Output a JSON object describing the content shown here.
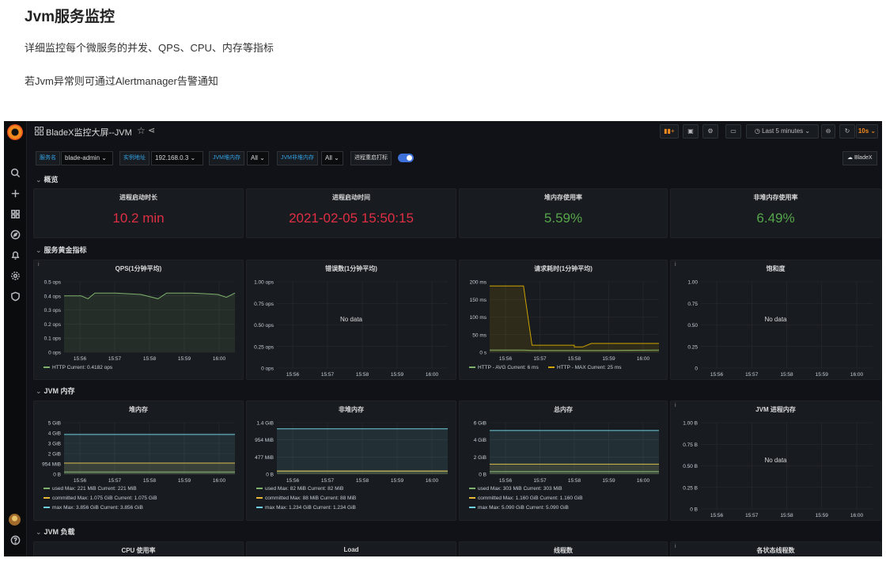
{
  "article": {
    "title": "Jvm服务监控",
    "desc1": "详细监控每个微服务的并发、QPS、CPU、内存等指标",
    "desc2": "若Jvm异常则可通过Alertmanager告警通知"
  },
  "dashboard": {
    "title": "BladeX监控大屏--JVM",
    "time_range": "Last 5 minutes",
    "refresh": "10s",
    "link": "BladeX",
    "vars": [
      {
        "label": "服务名",
        "value": "blade-admin"
      },
      {
        "label": "实例地址",
        "value": "192.168.0.3"
      },
      {
        "label": "JVM堆内存",
        "value": "All"
      },
      {
        "label": "JVM非堆内存",
        "value": "All"
      }
    ],
    "toggle_label": "进程重启打标"
  },
  "rows": {
    "overview": "概览",
    "golden": "服务黄金指标",
    "jvm_mem": "JVM 内存",
    "jvm_load": "JVM 负载"
  },
  "stats": [
    {
      "title": "进程启动时长",
      "value": "10.2 min",
      "color": "#e02f44"
    },
    {
      "title": "进程启动时间",
      "value": "2021-02-05 15:50:15",
      "color": "#e02f44"
    },
    {
      "title": "堆内存使用率",
      "value": "5.59%",
      "color": "#56a64b"
    },
    {
      "title": "非堆内存使用率",
      "value": "6.49%",
      "color": "#56a64b"
    }
  ],
  "nodata_text": "No data",
  "chart_data": [
    {
      "type": "line",
      "title": "QPS(1分钟平均)",
      "x": [
        "15:56",
        "15:57",
        "15:58",
        "15:59",
        "16:00"
      ],
      "yticks": [
        "0 ops",
        "0.1 ops",
        "0.2 ops",
        "0.3 ops",
        "0.4 ops",
        "0.5 ops"
      ],
      "ylim": [
        0,
        0.5
      ],
      "series": [
        {
          "name": "HTTP",
          "legend": "HTTP  Current: 0.4182 ops",
          "color": "#7eb26d",
          "points": [
            [
              0,
              0.4
            ],
            [
              0.1,
              0.4
            ],
            [
              0.14,
              0.38
            ],
            [
              0.18,
              0.42
            ],
            [
              0.3,
              0.42
            ],
            [
              0.45,
              0.41
            ],
            [
              0.55,
              0.38
            ],
            [
              0.6,
              0.42
            ],
            [
              0.75,
              0.42
            ],
            [
              0.9,
              0.41
            ],
            [
              0.95,
              0.39
            ],
            [
              1,
              0.42
            ]
          ]
        }
      ]
    },
    {
      "type": "line",
      "title": "错误数(1分钟平均)",
      "x": [
        "15:56",
        "15:57",
        "15:58",
        "15:59",
        "16:00"
      ],
      "yticks": [
        "0 ops",
        "0.25 ops",
        "0.50 ops",
        "0.75 ops",
        "1.00 ops"
      ],
      "ylim": [
        0,
        1
      ],
      "series": []
    },
    {
      "type": "line",
      "title": "请求耗时(1分钟平均)",
      "x": [
        "15:56",
        "15:57",
        "15:58",
        "15:59",
        "16:00"
      ],
      "yticks": [
        "0 s",
        "50 ms",
        "100 ms",
        "150 ms",
        "200 ms"
      ],
      "ylim": [
        0,
        200
      ],
      "series": [
        {
          "name": "HTTP - AVG",
          "legend": "HTTP - AVG  Current: 6 ms",
          "color": "#7eb26d",
          "points": [
            [
              0,
              6
            ],
            [
              0.2,
              6
            ],
            [
              0.25,
              5
            ],
            [
              0.5,
              5
            ],
            [
              0.6,
              5
            ],
            [
              1,
              6
            ]
          ]
        },
        {
          "name": "HTTP - MAX",
          "legend": "HTTP - MAX  Current: 25 ms",
          "color": "#cca300",
          "points": [
            [
              0,
              188
            ],
            [
              0.2,
              188
            ],
            [
              0.25,
              20
            ],
            [
              0.5,
              20
            ],
            [
              0.5,
              15
            ],
            [
              0.55,
              15
            ],
            [
              0.6,
              25
            ],
            [
              1,
              25
            ]
          ]
        }
      ]
    },
    {
      "type": "line",
      "title": "饱和度",
      "x": [
        "15:56",
        "15:57",
        "15:58",
        "15:59",
        "16:00"
      ],
      "yticks": [
        "0",
        "0.25",
        "0.50",
        "0.75",
        "1.00"
      ],
      "ylim": [
        0,
        1
      ],
      "series": []
    },
    {
      "type": "line",
      "title": "堆内存",
      "x": [
        "15:56",
        "15:57",
        "15:58",
        "15:59",
        "16:00"
      ],
      "yticks": [
        "0 B",
        "954 MiB",
        "2 GiB",
        "3 GiB",
        "4 GiB",
        "5 GiB"
      ],
      "ylim": [
        0,
        5
      ],
      "series": [
        {
          "name": "used",
          "legend": "used  Max: 221 MiB  Current: 221 MiB",
          "color": "#7eb26d",
          "points": [
            [
              0,
              0.216
            ],
            [
              1,
              0.216
            ]
          ]
        },
        {
          "name": "committed",
          "legend": "committed  Max: 1.075 GiB  Current: 1.075 GiB",
          "color": "#eab839",
          "points": [
            [
              0,
              1.075
            ],
            [
              1,
              1.075
            ]
          ]
        },
        {
          "name": "max",
          "legend": "max  Max: 3.856 GiB  Current: 3.856 GiB",
          "color": "#6ed0e0",
          "points": [
            [
              0,
              3.856
            ],
            [
              1,
              3.856
            ]
          ]
        }
      ]
    },
    {
      "type": "line",
      "title": "非堆内存",
      "x": [
        "15:56",
        "15:57",
        "15:58",
        "15:59",
        "16:00"
      ],
      "yticks": [
        "0 B",
        "477 MiB",
        "954 MiB",
        "1.4 GiB"
      ],
      "ylim": [
        0,
        1.4
      ],
      "series": [
        {
          "name": "used",
          "legend": "used  Max: 82 MiB  Current: 82 MiB",
          "color": "#7eb26d",
          "points": [
            [
              0,
              0.08
            ],
            [
              1,
              0.08
            ]
          ]
        },
        {
          "name": "committed",
          "legend": "committed  Max: 88 MiB  Current: 88 MiB",
          "color": "#eab839",
          "points": [
            [
              0,
              0.086
            ],
            [
              1,
              0.086
            ]
          ]
        },
        {
          "name": "max",
          "legend": "max  Max: 1.234 GiB  Current: 1.234 GiB",
          "color": "#6ed0e0",
          "points": [
            [
              0,
              1.234
            ],
            [
              1,
              1.234
            ]
          ]
        }
      ]
    },
    {
      "type": "line",
      "title": "总内存",
      "x": [
        "15:56",
        "15:57",
        "15:58",
        "15:59",
        "16:00"
      ],
      "yticks": [
        "0 B",
        "2 GiB",
        "4 GiB",
        "6 GiB"
      ],
      "ylim": [
        0,
        6
      ],
      "series": [
        {
          "name": "used",
          "legend": "used  Max: 303 MiB  Current: 303 MiB",
          "color": "#7eb26d",
          "points": [
            [
              0,
              0.296
            ],
            [
              1,
              0.296
            ]
          ]
        },
        {
          "name": "committed",
          "legend": "committed  Max: 1.160 GiB  Current: 1.160 GiB",
          "color": "#eab839",
          "points": [
            [
              0,
              1.16
            ],
            [
              1,
              1.16
            ]
          ]
        },
        {
          "name": "max",
          "legend": "max  Max: 5.090 GiB  Current: 5.090 GiB",
          "color": "#6ed0e0",
          "points": [
            [
              0,
              5.09
            ],
            [
              1,
              5.09
            ]
          ]
        }
      ]
    },
    {
      "type": "line",
      "title": "JVM 进程内存",
      "x": [
        "15:56",
        "15:57",
        "15:58",
        "15:59",
        "16:00"
      ],
      "yticks": [
        "0 B",
        "0.25 B",
        "0.50 B",
        "0.75 B",
        "1.00 B"
      ],
      "ylim": [
        0,
        1
      ],
      "series": []
    }
  ],
  "load_panels": [
    "CPU 使用率",
    "Load",
    "线程数",
    "各状态线程数"
  ]
}
